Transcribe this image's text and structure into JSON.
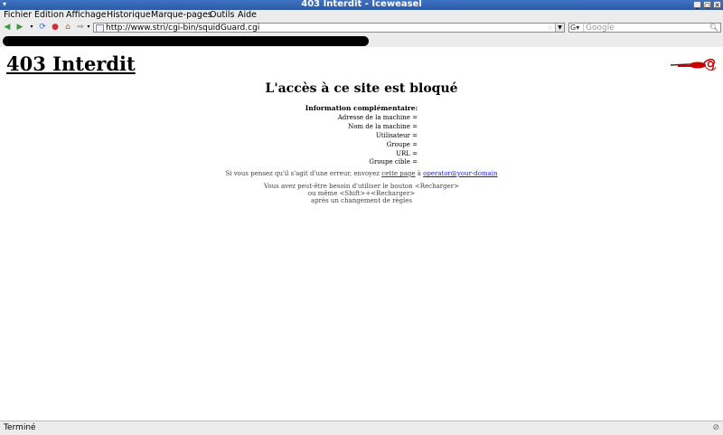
{
  "window": {
    "title": "403 Interdit - Iceweasel",
    "controls": [
      "_",
      "▢",
      "✕"
    ]
  },
  "menubar": {
    "items": [
      "Fichier",
      "Édition",
      "Affichage",
      "Historique",
      "Marque-pages",
      "Outils",
      "Aide"
    ]
  },
  "navbar": {
    "url": "http://www.stri/cgi-bin/squidGuard.cgi",
    "search_placeholder": "Google",
    "icons": [
      "back-icon",
      "forward-icon",
      "reload-icon",
      "stop-icon",
      "home-icon",
      "go-icon"
    ]
  },
  "page": {
    "heading": "403 Interdit",
    "blocked_title": "L'accès à ce site est bloqué",
    "info_title": "Information complémentaire:",
    "info_rows": [
      "Adresse de la machine =",
      "Nom de la machine =",
      "Utilisateur =",
      "Groupe =",
      "URL =",
      "Groupe cible ="
    ],
    "error_msg_prefix": "Si vous pensez qu'il s'agit d'une erreur, envoyez ",
    "error_link_page": "cette page",
    "error_msg_mid": " à ",
    "error_link_email": "operator@your-domain",
    "reload_lines": [
      "Vous avez peut-être besoin d'utiliser le bouton <Recharger>",
      "ou même <Shift>+<Recharger>",
      "après un changement de règles"
    ]
  },
  "status": {
    "text": "Terminé"
  }
}
